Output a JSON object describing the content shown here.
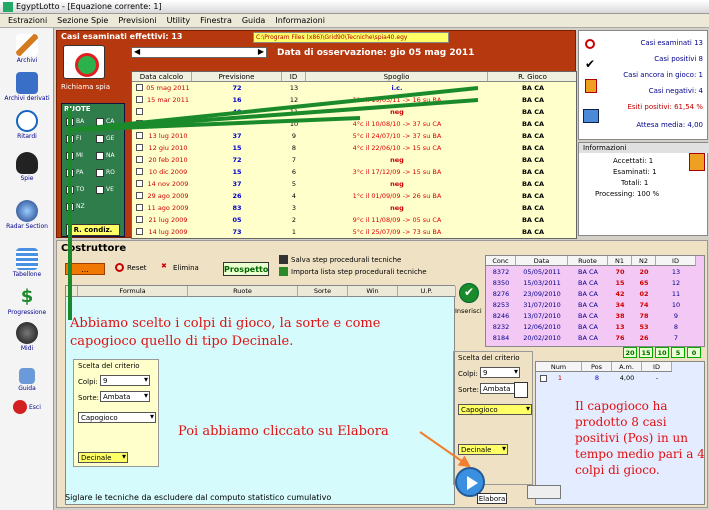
{
  "window": {
    "title": "EgyptLotto - [Equazione corrente: 1]"
  },
  "menu": [
    "Estrazioni",
    "Sezione Spie",
    "Previsioni",
    "Utility",
    "Finestra",
    "Guida",
    "Informazioni"
  ],
  "sidebar": [
    {
      "label": "Archivi",
      "icon": "pencil-icon"
    },
    {
      "label": "Archivi derivati",
      "icon": "book-icon"
    },
    {
      "label": "Ritardi",
      "icon": "clock-icon"
    },
    {
      "label": "Spie",
      "icon": "spy-icon"
    },
    {
      "label": "Radar Section",
      "icon": "radar-icon"
    },
    {
      "label": "Tabellone",
      "icon": "table-icon"
    },
    {
      "label": "Progressione",
      "icon": "dollar-icon"
    },
    {
      "label": "Midi",
      "icon": "music-icon"
    },
    {
      "label": "Guida",
      "icon": "help-icon"
    },
    {
      "label": "Esci",
      "icon": "exit-icon"
    }
  ],
  "top": {
    "casi_label": "Casi esaminati effettivi: 13",
    "path": "C:\\Program Files (x86)\\Grid90\\Tecniche\\spia40.egy",
    "data_osservazione": "Data di osservazione:  gio 05 mag 2011",
    "richiama": "Richiama spia",
    "ruote_title": "RUOTE",
    "ruote": [
      "BA",
      "CA",
      "FI",
      "GE",
      "MI",
      "NA",
      "PA",
      "RO",
      "TO",
      "VE",
      "NZ"
    ],
    "rcondiz": "R. condiz.",
    "table_headers": [
      "Data calcolo",
      "Previsione",
      "ID",
      "Spoglio",
      "R. Gioco"
    ],
    "rows": [
      {
        "d": "05 mag 2011",
        "p": "72",
        "id": "13",
        "s": "i.c.",
        "r": "BA CA"
      },
      {
        "d": "15 mar 2011",
        "p": "16",
        "id": "12",
        "s": "1°c il 19/03/11 -> 16 su BA",
        "r": "BA CA"
      },
      {
        "d": "",
        "p": "40",
        "id": "11",
        "s": "neg",
        "r": "BA CA"
      },
      {
        "d": "31 lug 2010",
        "p": "",
        "id": "10",
        "s": "4°c il 10/08/10 -> 37 su CA",
        "r": "BA CA"
      },
      {
        "d": "13 lug 2010",
        "p": "37",
        "id": "9",
        "s": "5°c il 24/07/10 -> 37 su BA",
        "r": "BA CA"
      },
      {
        "d": "12 giu 2010",
        "p": "15",
        "id": "8",
        "s": "4°c il 22/06/10 -> 15 su CA",
        "r": "BA CA"
      },
      {
        "d": "20 feb 2010",
        "p": "72",
        "id": "7",
        "s": "neg",
        "r": "BA CA"
      },
      {
        "d": "10 dic 2009",
        "p": "15",
        "id": "6",
        "s": "3°c il 17/12/09 -> 15 su BA",
        "r": "BA CA"
      },
      {
        "d": "14 nov 2009",
        "p": "37",
        "id": "5",
        "s": "neg",
        "r": "BA CA"
      },
      {
        "d": "29 ago 2009",
        "p": "26",
        "id": "4",
        "s": "1°c il 01/09/09 -> 26 su BA",
        "r": "BA CA"
      },
      {
        "d": "11 ago 2009",
        "p": "83",
        "id": "3",
        "s": "neg",
        "r": "BA CA"
      },
      {
        "d": "21 lug 2009",
        "p": "05",
        "id": "2",
        "s": "9°c il 11/08/09 -> 05 su CA",
        "r": "BA CA"
      },
      {
        "d": "14 lug 2009",
        "p": "73",
        "id": "1",
        "s": "5°c il 25/07/09 -> 73 su BA",
        "r": "BA CA"
      }
    ]
  },
  "stats": {
    "esaminati": "Casi esaminati 13",
    "positivi": "Casi positivi 8",
    "ancora": "Casi ancora in gioco: 1",
    "negativi": "Casi negativi: 4",
    "esiti": "Esiti positivi: 61,54 %",
    "attesa": "Attesa media: 4,00"
  },
  "info": {
    "title": "Informazioni",
    "accettati": "Accettati:  1",
    "esaminati": "Esaminati:  1",
    "totali": "Totali:  1",
    "processing": "Processing:  100 %"
  },
  "costruttore": {
    "title": "Costruttore",
    "orange_btn": "...",
    "reset": "Reset",
    "elimina": "Elimina",
    "prospetto": "Prospetto",
    "salva": "Salva step procedurali tecniche",
    "importa": "Importa lista step procedurali tecniche",
    "headers": [
      "Formula",
      "Ruote",
      "Sorte",
      "Win",
      "U.P."
    ],
    "inserisci": "Inserisci",
    "footer": "Siglare le tecniche da escludere dal computo statistico cumulativo",
    "elabora": "Elabora"
  },
  "conc": {
    "headers": [
      "Conc",
      "Data",
      "Ruote",
      "N1",
      "N2",
      "ID"
    ],
    "rows": [
      [
        "8372",
        "05/05/2011",
        "BA CA",
        "70",
        "20",
        "13"
      ],
      [
        "8350",
        "15/03/2011",
        "BA CA",
        "15",
        "65",
        "12"
      ],
      [
        "8276",
        "23/09/2010",
        "BA CA",
        "42",
        "02",
        "11"
      ],
      [
        "8253",
        "31/07/2010",
        "BA CA",
        "34",
        "74",
        "10"
      ],
      [
        "8246",
        "13/07/2010",
        "BA CA",
        "38",
        "78",
        "9"
      ],
      [
        "8232",
        "12/06/2010",
        "BA CA",
        "13",
        "53",
        "8"
      ],
      [
        "8184",
        "20/02/2010",
        "BA CA",
        "76",
        "26",
        "7"
      ]
    ],
    "counts": [
      "20",
      "15",
      "10",
      "5",
      "0"
    ]
  },
  "num_table": {
    "headers": [
      "Num",
      "Pos",
      "A.m.",
      "ID"
    ],
    "row": [
      "1",
      "8",
      "4,00",
      "-"
    ]
  },
  "criterio": {
    "title": "Scelta del criterio",
    "colpi_label": "Colpi:",
    "colpi": "9",
    "sorte_label": "Sorte:",
    "sorte": "Ambata",
    "capogioco": "Capogioco",
    "decinale": "Decinale"
  },
  "annotations": {
    "a1": "Abbiamo scelto i colpi di gioco, la sorte e come capogioco quello di tipo Decinale.",
    "a2": "Poi abbiamo cliccato su Elabora",
    "a3": "Il capogioco ha prodotto 8 casi positivi (Pos) in un tempo medio pari a 4 colpi di gioco."
  },
  "colors": {
    "panel": "#b6380e",
    "ruote": "#2e7d4b",
    "annotation": "#e01010",
    "arrow": "#1a8a2a"
  }
}
